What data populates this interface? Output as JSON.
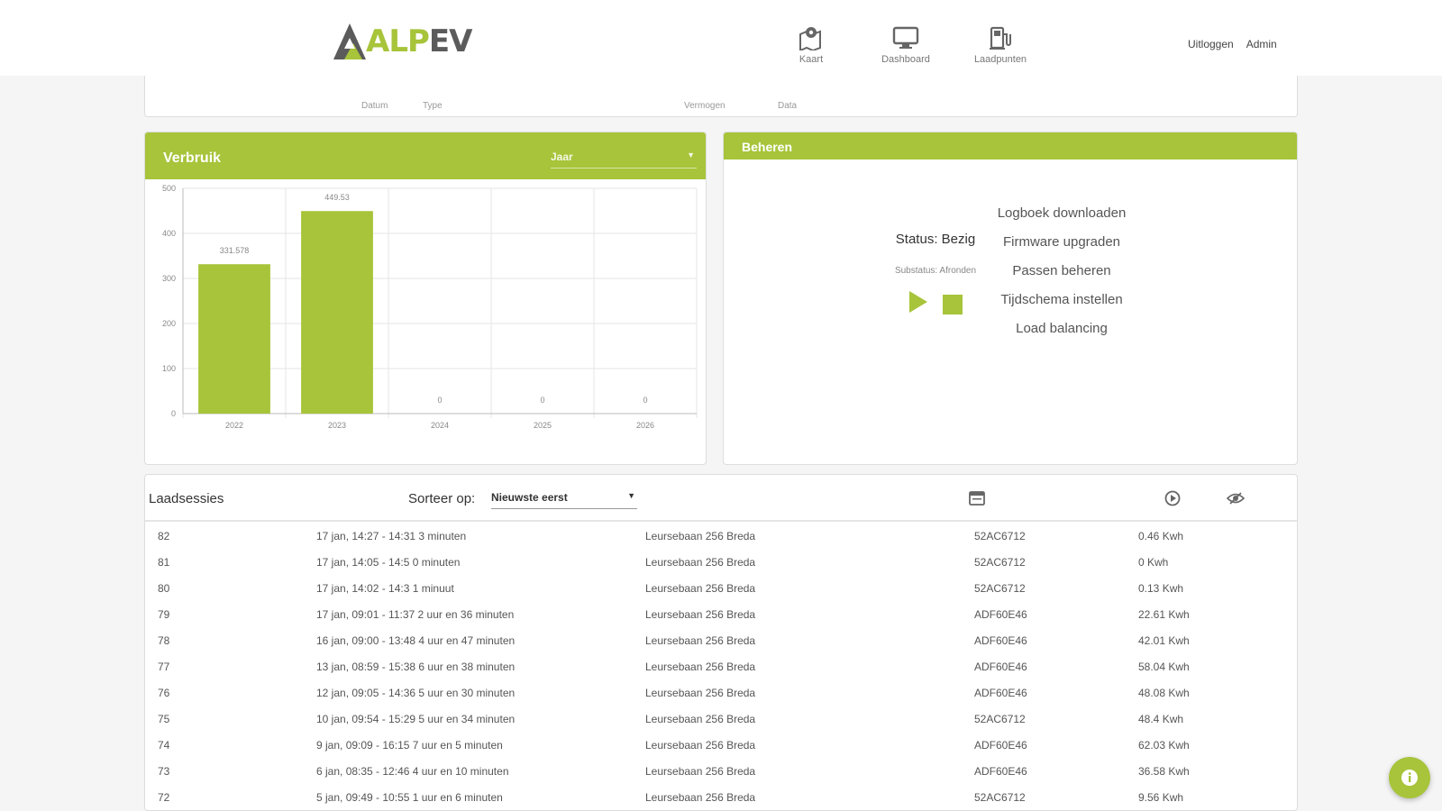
{
  "header": {
    "logo_text_a": "ALP",
    "logo_text_b": "EV",
    "nav": [
      {
        "label": "Kaart",
        "icon": "map-icon"
      },
      {
        "label": "Dashboard",
        "icon": "monitor-icon"
      },
      {
        "label": "Laadpunten",
        "icon": "charger-icon"
      }
    ],
    "logout_label": "Uitloggen",
    "user_label": "Admin"
  },
  "filterstrip": {
    "items": [
      "Datum",
      "Type",
      "Vermogen",
      "Data"
    ]
  },
  "verbruik": {
    "title": "Verbruik",
    "period_value": "Jaar"
  },
  "chart_data": {
    "type": "bar",
    "categories": [
      "2022",
      "2023",
      "2024",
      "2025",
      "2026"
    ],
    "values": [
      331.578,
      449.53,
      0,
      0,
      0
    ],
    "data_labels": [
      "331.578",
      "449.53",
      "0",
      "0",
      "0"
    ],
    "ylim": [
      0,
      500
    ],
    "yticks": [
      0,
      100,
      200,
      300,
      400,
      500
    ],
    "grid": true,
    "color": "#a7c43a"
  },
  "beheren": {
    "title": "Beheren",
    "status": "Status: Bezig",
    "substatus": "Substatus: Afronden",
    "menu": [
      "Logboek downloaden",
      "Firmware upgraden",
      "Passen beheren",
      "Tijdschema instellen",
      "Load balancing"
    ]
  },
  "sessions": {
    "title": "Laadsessies",
    "sort_label": "Sorteer op:",
    "sort_value": "Nieuwste eerst",
    "rows": [
      {
        "id": "82",
        "time": "17 jan, 14:27 - 14:31 3 minuten",
        "address": "Leursebaan 256 Breda",
        "card": "52AC6712",
        "energy": "0.46 Kwh"
      },
      {
        "id": "81",
        "time": "17 jan, 14:05 - 14:5 0 minuten",
        "address": "Leursebaan 256 Breda",
        "card": "52AC6712",
        "energy": "0 Kwh"
      },
      {
        "id": "80",
        "time": "17 jan, 14:02 - 14:3 1 minuut",
        "address": "Leursebaan 256 Breda",
        "card": "52AC6712",
        "energy": "0.13 Kwh"
      },
      {
        "id": "79",
        "time": "17 jan, 09:01 - 11:37 2 uur en 36 minuten",
        "address": "Leursebaan 256 Breda",
        "card": "ADF60E46",
        "energy": "22.61 Kwh"
      },
      {
        "id": "78",
        "time": "16 jan, 09:00 - 13:48 4 uur en 47 minuten",
        "address": "Leursebaan 256 Breda",
        "card": "ADF60E46",
        "energy": "42.01 Kwh"
      },
      {
        "id": "77",
        "time": "13 jan, 08:59 - 15:38 6 uur en 38 minuten",
        "address": "Leursebaan 256 Breda",
        "card": "ADF60E46",
        "energy": "58.04 Kwh"
      },
      {
        "id": "76",
        "time": "12 jan, 09:05 - 14:36 5 uur en 30 minuten",
        "address": "Leursebaan 256 Breda",
        "card": "ADF60E46",
        "energy": "48.08 Kwh"
      },
      {
        "id": "75",
        "time": "10 jan, 09:54 - 15:29 5 uur en 34 minuten",
        "address": "Leursebaan 256 Breda",
        "card": "52AC6712",
        "energy": "48.4 Kwh"
      },
      {
        "id": "74",
        "time": "9 jan, 09:09 - 16:15 7 uur en 5 minuten",
        "address": "Leursebaan 256 Breda",
        "card": "ADF60E46",
        "energy": "62.03 Kwh"
      },
      {
        "id": "73",
        "time": "6 jan, 08:35 - 12:46 4 uur en 10 minuten",
        "address": "Leursebaan 256 Breda",
        "card": "ADF60E46",
        "energy": "36.58 Kwh"
      },
      {
        "id": "72",
        "time": "5 jan, 09:49 - 10:55 1 uur en 6 minuten",
        "address": "Leursebaan 256 Breda",
        "card": "52AC6712",
        "energy": "9.56 Kwh"
      }
    ]
  }
}
